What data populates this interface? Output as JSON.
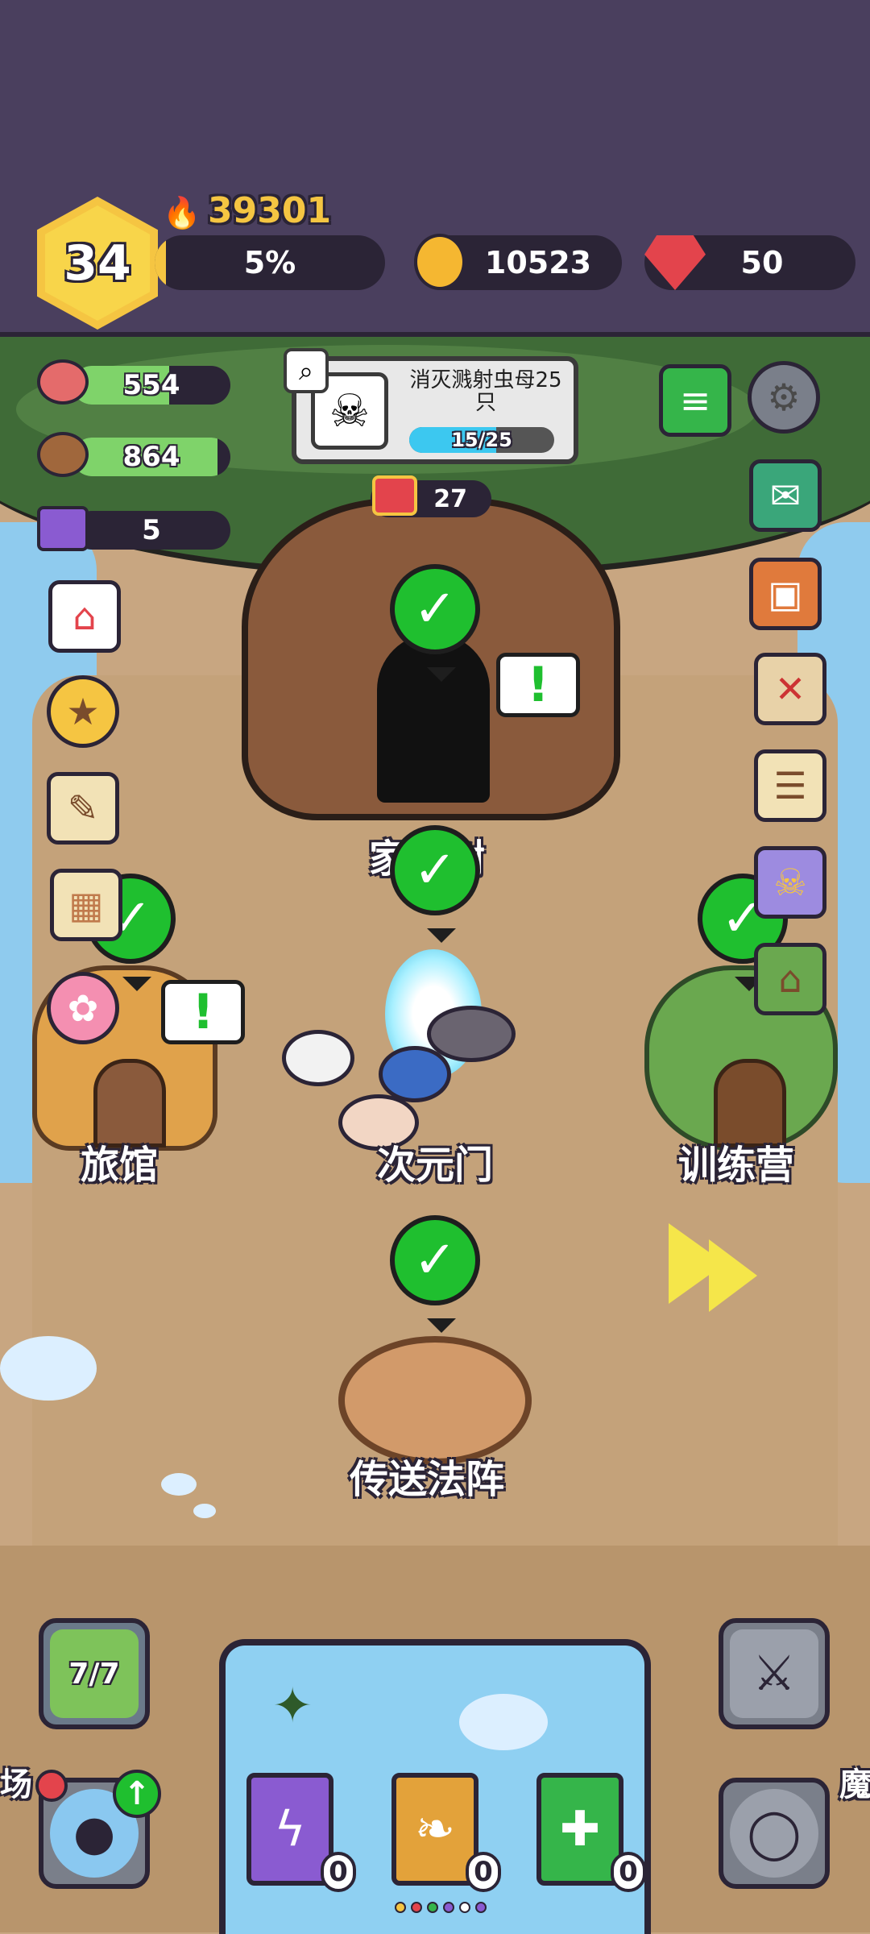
{
  "hud": {
    "level": "34",
    "power": "39301",
    "xp_percent_label": "5%",
    "xp_fraction": 0.05,
    "gold": "10523",
    "gems": "50"
  },
  "resources": {
    "meat": "554",
    "wood": "864",
    "crystal": "5"
  },
  "quest": {
    "title": "消灭溅射虫母25只",
    "progress_label": "15/25",
    "progress_value": 15,
    "progress_total": 25
  },
  "chest_count": "27",
  "buildings": {
    "tree": "家园树",
    "inn": "旅馆",
    "portal": "次元门",
    "camp": "训练营",
    "teleport": "传送法阵"
  },
  "bottom": {
    "slime_counter": "7/7",
    "left_edge_label": "场",
    "right_edge_label": "魔"
  },
  "books": [
    {
      "name": "lightning-book",
      "count": "0",
      "color": "#8a5bd1"
    },
    {
      "name": "wing-book",
      "count": "0",
      "color": "#e3a23a"
    },
    {
      "name": "heal-book",
      "count": "0",
      "color": "#35b54a"
    }
  ],
  "colors": {
    "hud_bg": "#4a3f5e",
    "check_green": "#1fbf2f",
    "gold": "#f5c542",
    "gem_red": "#e3444c"
  }
}
